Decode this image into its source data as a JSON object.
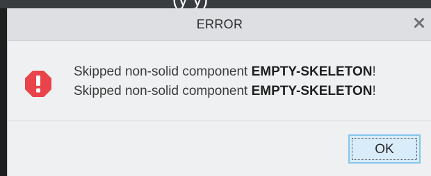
{
  "background": {
    "partial_text": "(y                            y)"
  },
  "dialog": {
    "title": "ERROR",
    "close_icon": "close-icon",
    "icon": "error-octagon-icon",
    "messages": [
      {
        "prefix": "Skipped non-solid component ",
        "component": "EMPTY-SKELETON",
        "suffix": "!"
      },
      {
        "prefix": "Skipped non-solid component ",
        "component": "EMPTY-SKELETON",
        "suffix": "!"
      }
    ],
    "ok_label": "OK"
  },
  "colors": {
    "error_red": "#e9434b",
    "ok_border": "#86c4ea",
    "ok_fill": "#d8ecf9",
    "titlebar": "#dddfe2",
    "dialog_bg": "#eff0f2"
  }
}
